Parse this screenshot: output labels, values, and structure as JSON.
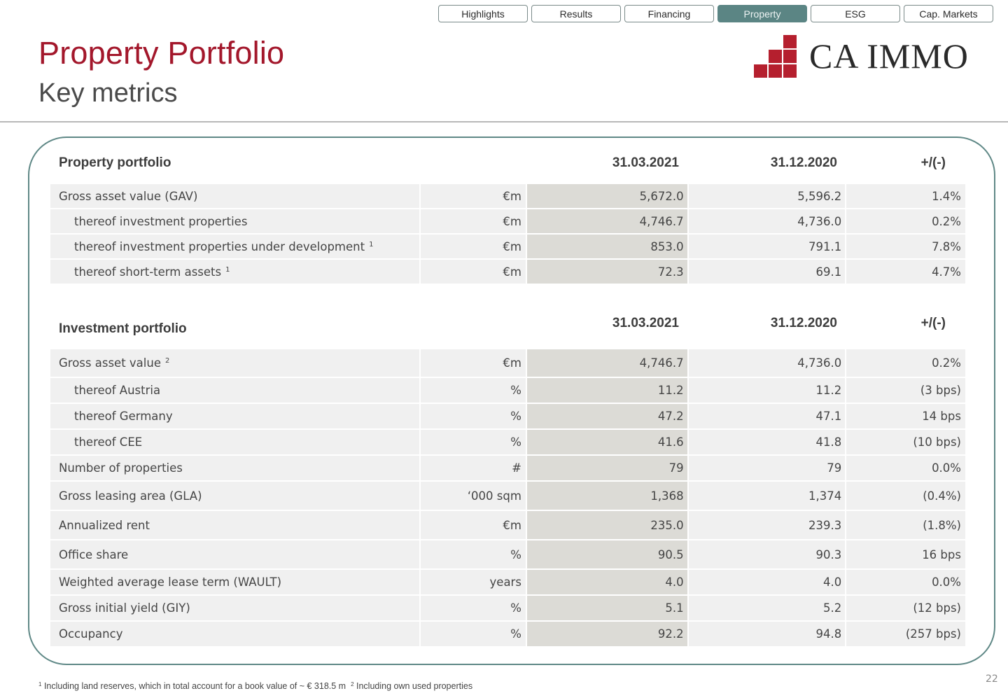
{
  "nav": {
    "tabs": [
      {
        "label": "Highlights",
        "active": false
      },
      {
        "label": "Results",
        "active": false
      },
      {
        "label": "Financing",
        "active": false
      },
      {
        "label": "Property",
        "active": true
      },
      {
        "label": "ESG",
        "active": false
      },
      {
        "label": "Cap. Markets",
        "active": false
      }
    ]
  },
  "header": {
    "title": "Property Portfolio",
    "subtitle": "Key metrics",
    "logo_text": "CA IMMO",
    "brand_color": "#b51f2e",
    "accent_color": "#5b8584"
  },
  "property_portfolio": {
    "title": "Property portfolio",
    "columns": [
      "31.03.2021",
      "31.12.2020",
      "+/(-)"
    ],
    "rows": [
      {
        "label": "Gross asset value (GAV)",
        "footnote": "",
        "indent": false,
        "unit": "€m",
        "current": "5,672.0",
        "previous": "5,596.2",
        "change": "1.4%"
      },
      {
        "label": "thereof investment properties",
        "footnote": "",
        "indent": true,
        "unit": "€m",
        "current": "4,746.7",
        "previous": "4,736.0",
        "change": "0.2%"
      },
      {
        "label": "thereof investment properties under development",
        "footnote": "1",
        "indent": true,
        "unit": "€m",
        "current": "853.0",
        "previous": "791.1",
        "change": "7.8%"
      },
      {
        "label": "thereof short-term assets",
        "footnote": "1",
        "indent": true,
        "unit": "€m",
        "current": "72.3",
        "previous": "69.1",
        "change": "4.7%"
      }
    ]
  },
  "investment_portfolio": {
    "title": "Investment portfolio",
    "columns": [
      "31.03.2021",
      "31.12.2020",
      "+/(-)"
    ],
    "rows": [
      {
        "label": "Gross asset value",
        "footnote": "2",
        "indent": false,
        "unit": "€m",
        "current": "4,746.7",
        "previous": "4,736.0",
        "change": "0.2%"
      },
      {
        "label": "thereof Austria",
        "footnote": "",
        "indent": true,
        "unit": "%",
        "current": "11.2",
        "previous": "11.2",
        "change": "(3 bps)"
      },
      {
        "label": "thereof Germany",
        "footnote": "",
        "indent": true,
        "unit": "%",
        "current": "47.2",
        "previous": "47.1",
        "change": "14 bps"
      },
      {
        "label": "thereof CEE",
        "footnote": "",
        "indent": true,
        "unit": "%",
        "current": "41.6",
        "previous": "41.8",
        "change": "(10 bps)"
      },
      {
        "label": "Number of properties",
        "footnote": "",
        "indent": false,
        "unit": "#",
        "current": "79",
        "previous": "79",
        "change": "0.0%"
      },
      {
        "label": "Gross leasing area (GLA)",
        "footnote": "",
        "indent": false,
        "unit": "‘000 sqm",
        "current": "1,368",
        "previous": "1,374",
        "change": "(0.4%)"
      },
      {
        "label": "Annualized rent",
        "footnote": "",
        "indent": false,
        "unit": "€m",
        "current": "235.0",
        "previous": "239.3",
        "change": "(1.8%)"
      },
      {
        "label": "Office share",
        "footnote": "",
        "indent": false,
        "unit": "%",
        "current": "90.5",
        "previous": "90.3",
        "change": "16 bps"
      },
      {
        "label": "Weighted average lease term (WAULT)",
        "footnote": "",
        "indent": false,
        "unit": "years",
        "current": "4.0",
        "previous": "4.0",
        "change": "0.0%"
      },
      {
        "label": "Gross initial yield (GIY)",
        "footnote": "",
        "indent": false,
        "unit": "%",
        "current": "5.1",
        "previous": "5.2",
        "change": "(12 bps)"
      },
      {
        "label": "Occupancy",
        "footnote": "",
        "indent": false,
        "unit": "%",
        "current": "92.2",
        "previous": "94.8",
        "change": "(257 bps)"
      }
    ]
  },
  "footnotes": [
    {
      "mark": "1",
      "text": "Including land reserves, which in total account for a book value of ~ € 318.5 m"
    },
    {
      "mark": "2",
      "text": "Including own used properties"
    }
  ],
  "page_number": "22"
}
